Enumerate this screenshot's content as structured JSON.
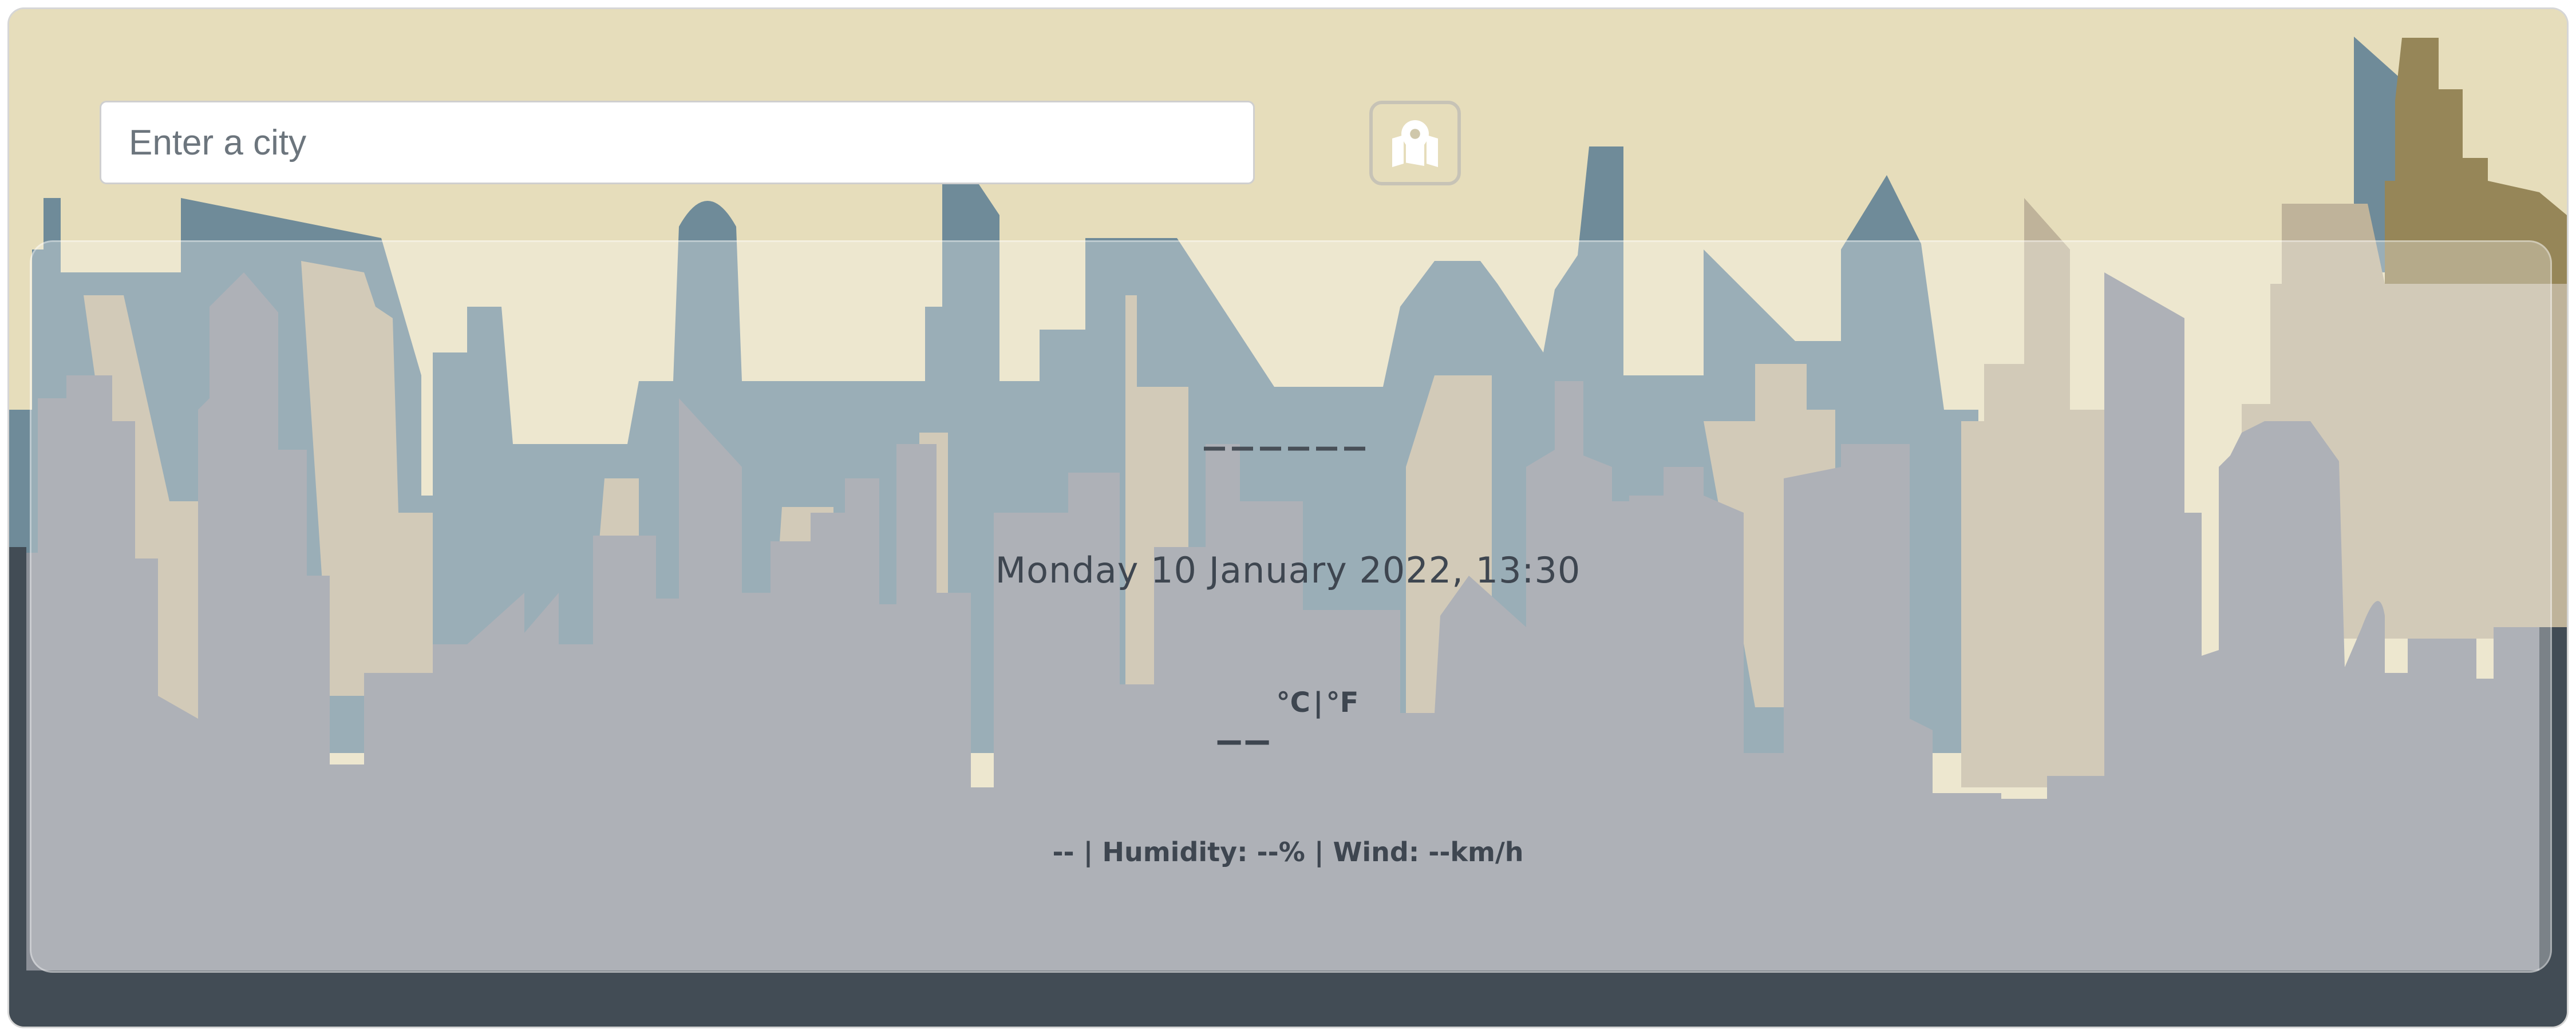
{
  "search": {
    "placeholder": "Enter a city"
  },
  "map_button": {
    "icon": "map-pin-icon"
  },
  "weather": {
    "city": "______",
    "date_time": "Monday 10 January 2022, 13:30",
    "temperature": "__",
    "unit_celsius": "°C",
    "unit_separator": "|",
    "unit_fahrenheit": "°F",
    "description": "--",
    "humidity_label": "Humidity:",
    "humidity_value": "--%",
    "wind_label": "Wind:",
    "wind_value": "--km/h",
    "separator": "|"
  },
  "colors": {
    "sky": "#e6ddbb",
    "skyline_blue": "#6f8b99",
    "skyline_tan": "#bfb39a",
    "skyline_gray": "#8c9098",
    "skyline_olive": "#968658",
    "ground": "#424c55"
  }
}
